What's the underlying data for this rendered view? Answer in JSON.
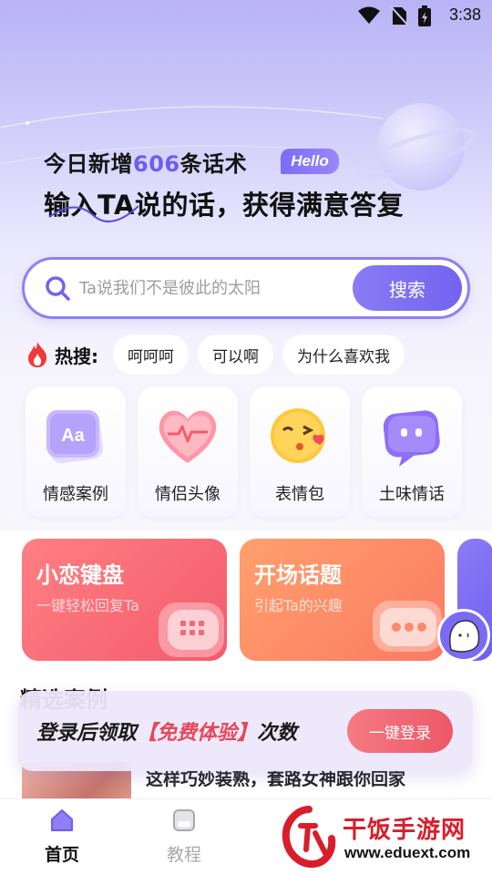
{
  "status_bar": {
    "time": "3:38"
  },
  "hero": {
    "line1_prefix": "今日新增",
    "line1_count": "606",
    "line1_suffix": "条话术",
    "hello_badge": "Hello",
    "line2": "输入TA说的话，获得满意答复"
  },
  "search": {
    "placeholder": "Ta说我们不是彼此的太阳",
    "button_label": "搜索"
  },
  "hot_search": {
    "label": "热搜:",
    "tags": [
      "呵呵呵",
      "可以啊",
      "为什么喜欢我"
    ]
  },
  "categories": [
    {
      "label": "情感案例",
      "icon": "aa-card-icon"
    },
    {
      "label": "情侣头像",
      "icon": "heart-icon"
    },
    {
      "label": "表情包",
      "icon": "emoji-kiss-icon"
    },
    {
      "label": "土味情话",
      "icon": "chat-bubble-icon"
    }
  ],
  "features": [
    {
      "title": "小恋键盘",
      "subtitle": "一键轻松回复Ta"
    },
    {
      "title": "开场话题",
      "subtitle": "引起Ta的兴趣"
    }
  ],
  "section": {
    "title": "精选案例"
  },
  "article": {
    "title": "这样巧妙装熟，套路女神跟你回家"
  },
  "login_banner": {
    "text_before": "登录后领取",
    "text_highlight": "【免费体验】",
    "text_after": "次数",
    "button_label": "一键登录"
  },
  "bottom_nav": [
    {
      "label": "首页"
    },
    {
      "label": "教程"
    }
  ],
  "watermark": {
    "title": "干饭手游网",
    "url": "www.eduext.com"
  },
  "colors": {
    "accent": "#7363ef",
    "red": "#ec5866",
    "orange": "#fb7a64"
  }
}
